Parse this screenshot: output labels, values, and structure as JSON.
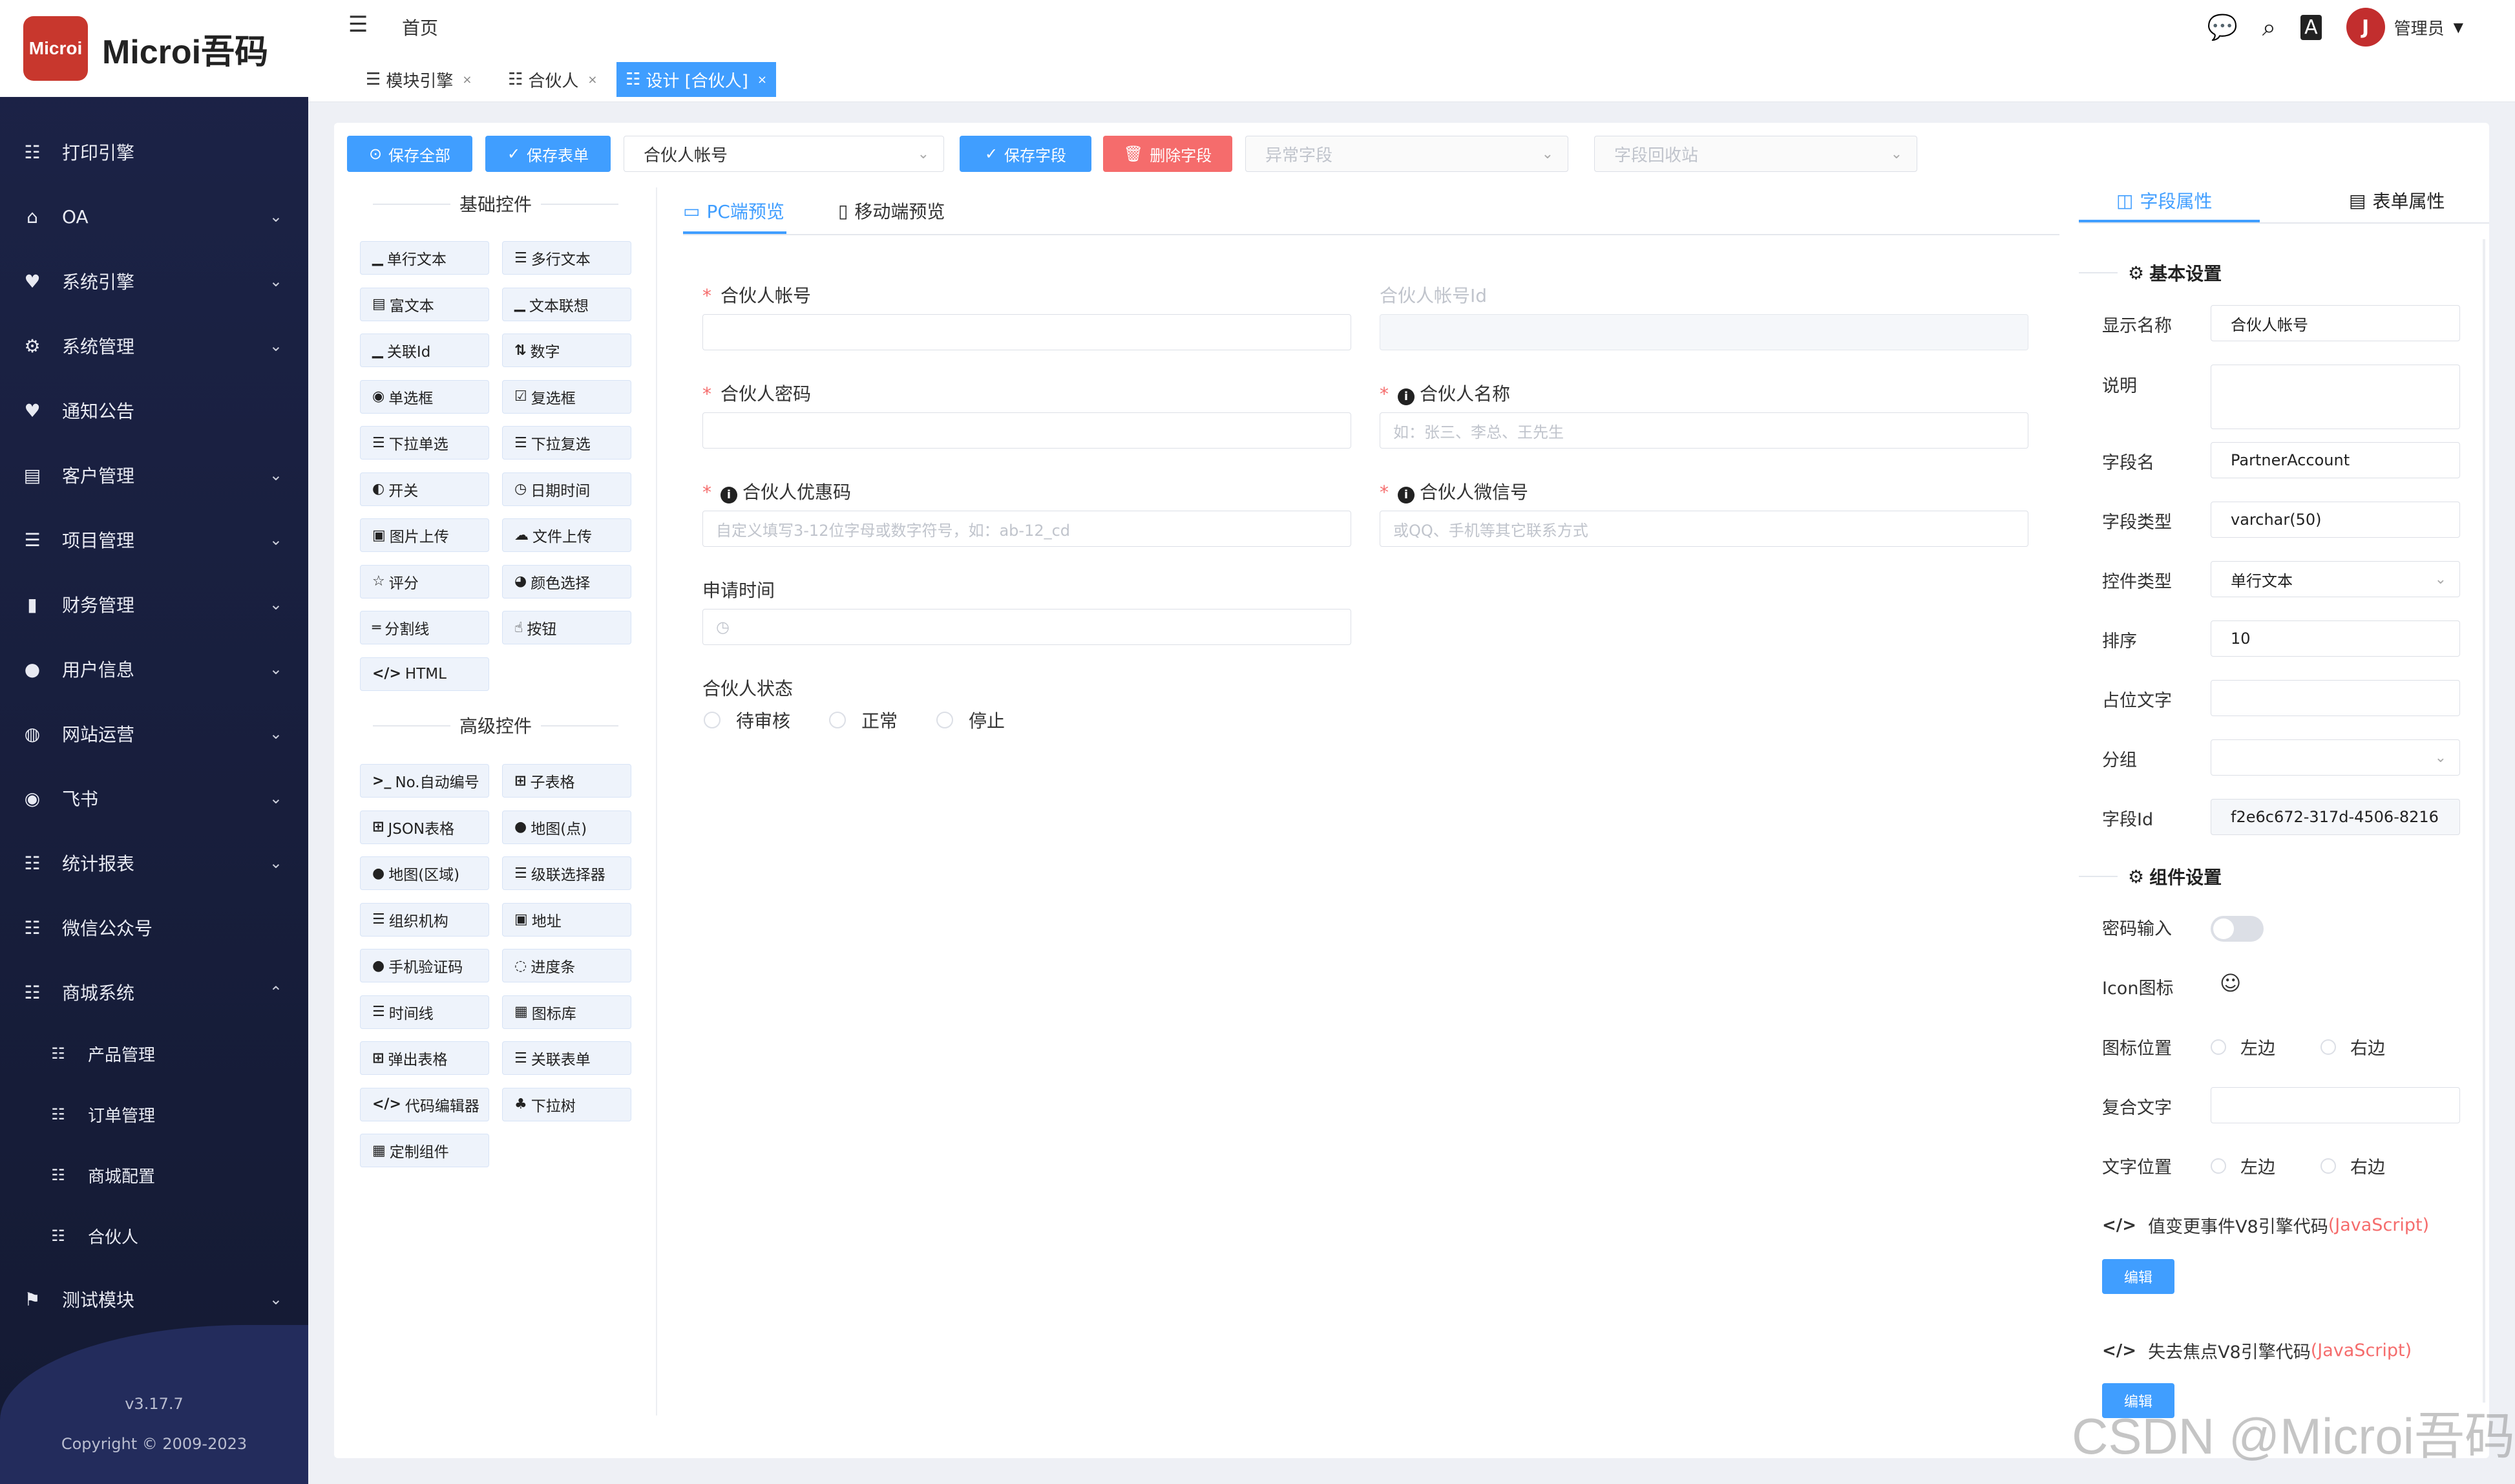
{
  "app": {
    "logo_mark": "Microi",
    "logo_text": "Microi吾码",
    "version": "v3.17.7",
    "copyright": "Copyright © 2009-2023"
  },
  "sidebar": {
    "items": [
      {
        "label": "打印引擎",
        "icon": "list-icon"
      },
      {
        "label": "OA",
        "icon": "home-icon",
        "expandable": true
      },
      {
        "label": "系统引擎",
        "icon": "heart-icon",
        "expandable": true
      },
      {
        "label": "系统管理",
        "icon": "gear-icon",
        "expandable": true
      },
      {
        "label": "通知公告",
        "icon": "heart-icon"
      },
      {
        "label": "客户管理",
        "icon": "id-card-icon",
        "expandable": true
      },
      {
        "label": "项目管理",
        "icon": "list-icon",
        "expandable": true
      },
      {
        "label": "财务管理",
        "icon": "file-icon",
        "expandable": true
      },
      {
        "label": "用户信息",
        "icon": "user-icon",
        "expandable": true
      },
      {
        "label": "网站运营",
        "icon": "globe-icon",
        "expandable": true
      },
      {
        "label": "飞书",
        "icon": "feishu-icon",
        "expandable": true
      },
      {
        "label": "统计报表",
        "icon": "list-icon",
        "expandable": true
      },
      {
        "label": "微信公众号",
        "icon": "list-icon"
      },
      {
        "label": "商城系统",
        "icon": "list-icon",
        "expandable": true,
        "expanded": true
      }
    ],
    "subitems": [
      "产品管理",
      "订单管理",
      "商城配置",
      "合伙人"
    ],
    "last_item": {
      "label": "测试模块",
      "icon": "run-icon"
    }
  },
  "header": {
    "breadcrumb_home": "首页",
    "user_name": "管理员",
    "avatar_letter": "J",
    "tabs": [
      {
        "label": "模块引擎",
        "active": false
      },
      {
        "label": "合伙人",
        "active": false
      },
      {
        "label": "设计 [合伙人]",
        "active": true
      }
    ]
  },
  "toolbar": {
    "save_all": "保存全部",
    "save_form": "保存表单",
    "field_select_value": "合伙人帐号",
    "save_field": "保存字段",
    "delete_field": "删除字段",
    "abnormal_fields_placeholder": "异常字段",
    "recycle_bin_placeholder": "字段回收站"
  },
  "palette": {
    "basic_title": "基础控件",
    "basic": [
      {
        "label": "单行文本",
        "icon": "▁"
      },
      {
        "label": "多行文本",
        "icon": "☰"
      },
      {
        "label": "富文本",
        "icon": "▤"
      },
      {
        "label": "文本联想",
        "icon": "▁"
      },
      {
        "label": "关联Id",
        "icon": "▁"
      },
      {
        "label": "数字",
        "icon": "⇅"
      },
      {
        "label": "单选框",
        "icon": "◉"
      },
      {
        "label": "复选框",
        "icon": "☑"
      },
      {
        "label": "下拉单选",
        "icon": "☰"
      },
      {
        "label": "下拉复选",
        "icon": "☰"
      },
      {
        "label": "开关",
        "icon": "◐"
      },
      {
        "label": "日期时间",
        "icon": "◷"
      },
      {
        "label": "图片上传",
        "icon": "▣"
      },
      {
        "label": "文件上传",
        "icon": "☁"
      },
      {
        "label": "评分",
        "icon": "☆"
      },
      {
        "label": "颜色选择",
        "icon": "◕"
      },
      {
        "label": "分割线",
        "icon": "═"
      },
      {
        "label": "按钮",
        "icon": "☝"
      },
      {
        "label": "HTML",
        "icon": "</>"
      }
    ],
    "advanced_title": "高级控件",
    "advanced": [
      {
        "label": "No.自动编号",
        "icon": ">_"
      },
      {
        "label": "子表格",
        "icon": "⊞"
      },
      {
        "label": "JSON表格",
        "icon": "⊞"
      },
      {
        "label": "地图(点)",
        "icon": "●"
      },
      {
        "label": "地图(区域)",
        "icon": "●"
      },
      {
        "label": "级联选择器",
        "icon": "☰"
      },
      {
        "label": "组织机构",
        "icon": "☰"
      },
      {
        "label": "地址",
        "icon": "▣"
      },
      {
        "label": "手机验证码",
        "icon": "●"
      },
      {
        "label": "进度条",
        "icon": "◌"
      },
      {
        "label": "时间线",
        "icon": "☰"
      },
      {
        "label": "图标库",
        "icon": "▦"
      },
      {
        "label": "弹出表格",
        "icon": "⊞"
      },
      {
        "label": "关联表单",
        "icon": "☰"
      },
      {
        "label": "代码编辑器",
        "icon": "</>"
      },
      {
        "label": "下拉树",
        "icon": "♣"
      },
      {
        "label": "定制组件",
        "icon": "▦"
      }
    ]
  },
  "preview": {
    "tab_pc": "PC端预览",
    "tab_mobile": "移动端预览",
    "fields": {
      "partner_account": {
        "label": "合伙人帐号",
        "required": true
      },
      "partner_account_id": {
        "label": "合伙人帐号Id",
        "disabled": true
      },
      "partner_password": {
        "label": "合伙人密码",
        "required": true
      },
      "partner_name": {
        "label": "合伙人名称",
        "required": true,
        "placeholder": "如：张三、李总、王先生"
      },
      "partner_discount": {
        "label": "合伙人优惠码",
        "required": true,
        "placeholder": "自定义填写3-12位字母或数字符号，如：ab-12_cd"
      },
      "partner_wechat": {
        "label": "合伙人微信号",
        "required": true,
        "placeholder": "或QQ、手机等其它联系方式"
      },
      "apply_time": {
        "label": "申请时间"
      },
      "partner_status": {
        "label": "合伙人状态",
        "options": [
          "待审核",
          "正常",
          "停止"
        ]
      }
    }
  },
  "props": {
    "tab_field": "字段属性",
    "tab_form": "表单属性",
    "basic_title": "基本设置",
    "display_name_label": "显示名称",
    "display_name": "合伙人帐号",
    "desc_label": "说明",
    "field_name_label": "字段名",
    "field_name": "PartnerAccount",
    "field_type_label": "字段类型",
    "field_type": "varchar(50)",
    "control_type_label": "控件类型",
    "control_type": "单行文本",
    "sort_label": "排序",
    "sort": "10",
    "placeholder_label": "占位文字",
    "group_label": "分组",
    "field_id_label": "字段Id",
    "field_id": "f2e6c672-317d-4506-8216",
    "component_title": "组件设置",
    "password_label": "密码输入",
    "icon_label": "Icon图标",
    "icon_glyph": "☺",
    "icon_position_label": "图标位置",
    "compound_text_label": "复合文字",
    "text_position_label": "文字位置",
    "left": "左边",
    "right": "右边",
    "on_change_code_label": "值变更事件V8引擎代码",
    "on_blur_code_label": "失去焦点V8引擎代码",
    "js_label": "(JavaScript)",
    "edit": "编辑"
  },
  "watermark": "CSDN @Microi吾码"
}
